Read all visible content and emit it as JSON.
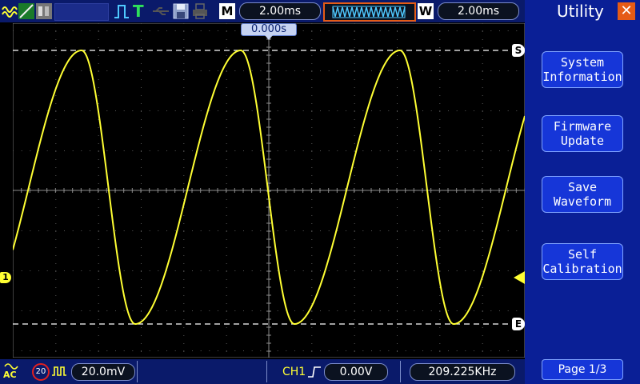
{
  "header": {
    "timebase": "2.00ms",
    "window_timebase": "2.00ms",
    "m_label": "M",
    "w_label": "W",
    "trigger_marker": "T",
    "trigger_position": "0.000s"
  },
  "waveform": {
    "channel_marker": "1",
    "cursor_s_label": "S",
    "cursor_e_label": "E",
    "trace_color": "#ffff33"
  },
  "footer": {
    "coupling": "AC",
    "bw_limit": "20",
    "volts_per_div": "20.0mV",
    "trigger_source": "CH1",
    "trigger_level": "0.00V",
    "frequency": "209.225KHz"
  },
  "menu": {
    "title": "Utility",
    "items": [
      {
        "label": "System\nInformation"
      },
      {
        "label": "Firmware\nUpdate"
      },
      {
        "label": "Save\nWaveform"
      },
      {
        "label": "Self\nCalibration"
      }
    ],
    "page": "Page 1/3"
  },
  "colors": {
    "panel": "#0a1f96",
    "accent": "#e55b16",
    "trace": "#ffff33"
  }
}
